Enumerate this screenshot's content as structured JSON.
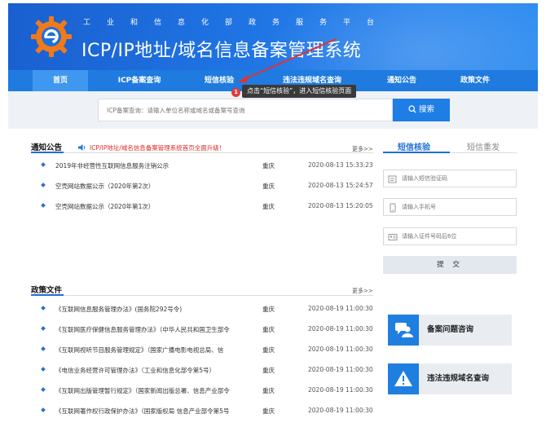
{
  "header": {
    "org_name": "工业和信息化部政务服务平台",
    "title": "ICP/IP地址/域名信息备案管理系统"
  },
  "nav": [
    {
      "label": "首页"
    },
    {
      "label": "ICP备案查询"
    },
    {
      "label": "短信核验"
    },
    {
      "label": "违法违规域名查询"
    },
    {
      "label": "通知公告"
    },
    {
      "label": "政策文件"
    }
  ],
  "annotation": {
    "badge": "1",
    "text": "点击“短信核验”，进入短信核验页面"
  },
  "search": {
    "placeholder": "ICP备案查询：请输入单位名称或域名或备案号查询",
    "button_label": "搜索"
  },
  "notices": {
    "title": "通知公告",
    "marquee": "ICP/IP地址/域名信息备案管理系统首页全面升级！",
    "more": "更多>>",
    "items": [
      {
        "title": "2019年非经营性互联网信息服务注销公示",
        "location": "重庆",
        "time": "2020-08-13 15:33:23"
      },
      {
        "title": "空壳网站数据公示（2020年第2次）",
        "location": "重庆",
        "time": "2020-08-13 15:24:57"
      },
      {
        "title": "空壳网站数据公示（2020年第1次）",
        "location": "重庆",
        "time": "2020-08-13 15:20:05"
      }
    ]
  },
  "policies": {
    "title": "政策文件",
    "more": "更多>>",
    "items": [
      {
        "title": "《互联网信息服务管理办法》(国务院292号令)",
        "location": "重庆",
        "time": "2020-08-19 11:00:30"
      },
      {
        "title": "《互联网医疗保健信息服务管理办法》（中华人民共和国卫生部令",
        "location": "重庆",
        "time": "2020-08-19 11:00:30"
      },
      {
        "title": "《互联网视听节目服务管理规定》（国家广播电影电视总局、信",
        "location": "重庆",
        "time": "2020-08-19 11:00:30"
      },
      {
        "title": "《电信业务经营许可管理办法》（工业和信息化部令第5号）",
        "location": "重庆",
        "time": "2020-08-19 11:00:30"
      },
      {
        "title": "《互联网出版管理暂行规定》（国家新闻出版总署、信息产业部令",
        "location": "重庆",
        "time": "2020-08-19 11:00:30"
      },
      {
        "title": "《互联网著作权行政保护办法》（国家版权局 信息产业部令第5号",
        "location": "重庆",
        "time": "2020-08-19 11:00:30"
      }
    ]
  },
  "sms_panel": {
    "tab_verify": "短信核验",
    "tab_resend": "短信重发",
    "code_placeholder": "请输入短信验证码",
    "phone_placeholder": "请输入手机号",
    "id_placeholder": "请输入证件号码后6位",
    "submit_label": "提 交"
  },
  "cards": {
    "consult_label": "备案问题咨询",
    "illegal_label": "违法违规域名查询"
  },
  "colors": {
    "primary": "#1f7bdf",
    "accent_red": "#e02828"
  }
}
